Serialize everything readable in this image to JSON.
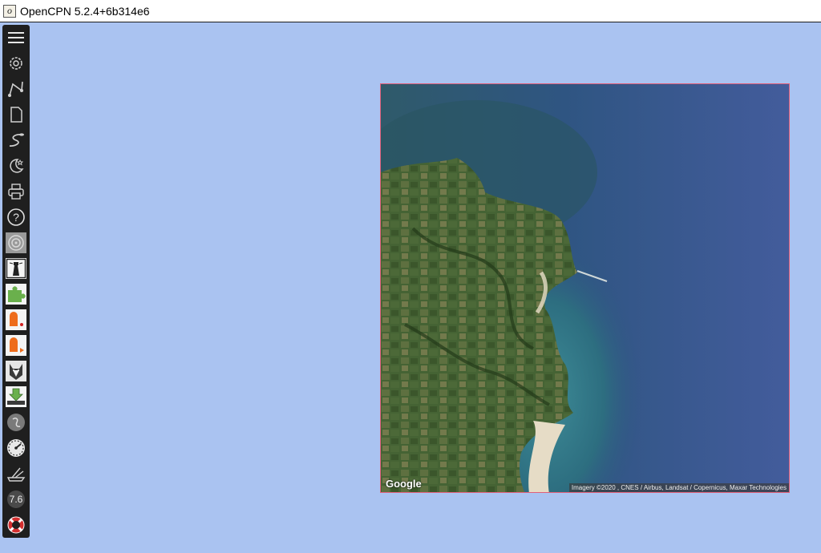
{
  "window": {
    "title": "OpenCPN 5.2.4+6b314e6",
    "icon": "opencpn-app-icon"
  },
  "toolbar": {
    "tools": [
      {
        "name": "menu-icon"
      },
      {
        "name": "settings-gear-icon"
      },
      {
        "name": "route-icon"
      },
      {
        "name": "route-manager-icon"
      },
      {
        "name": "track-icon"
      },
      {
        "name": "night-mode-icon"
      },
      {
        "name": "print-icon"
      },
      {
        "name": "help-icon"
      },
      {
        "name": "radar-plugin-icon"
      },
      {
        "name": "lighthouse-plugin-icon"
      },
      {
        "name": "plugin-puzzle-icon"
      },
      {
        "name": "orange-plugin-icon"
      },
      {
        "name": "orange-play-plugin-icon"
      },
      {
        "name": "husky-plugin-icon"
      },
      {
        "name": "download-plugin-icon"
      },
      {
        "name": "grey-globe-plugin-icon"
      },
      {
        "name": "gauge-dashboard-icon"
      },
      {
        "name": "ship-plugin-icon"
      },
      {
        "name": "version-plugin-icon"
      },
      {
        "name": "lifebuoy-plugin-icon"
      }
    ],
    "version_badge": "7.6"
  },
  "map_tile": {
    "logo": "Google",
    "attribution": "Imagery ©2020 , CNES / Airbus, Landsat / Copernicus, Maxar Technologies"
  },
  "colors": {
    "canvas_background": "#aac3f1",
    "toolbar_background": "#1f1f1f",
    "tile_border": "#e0607a"
  }
}
